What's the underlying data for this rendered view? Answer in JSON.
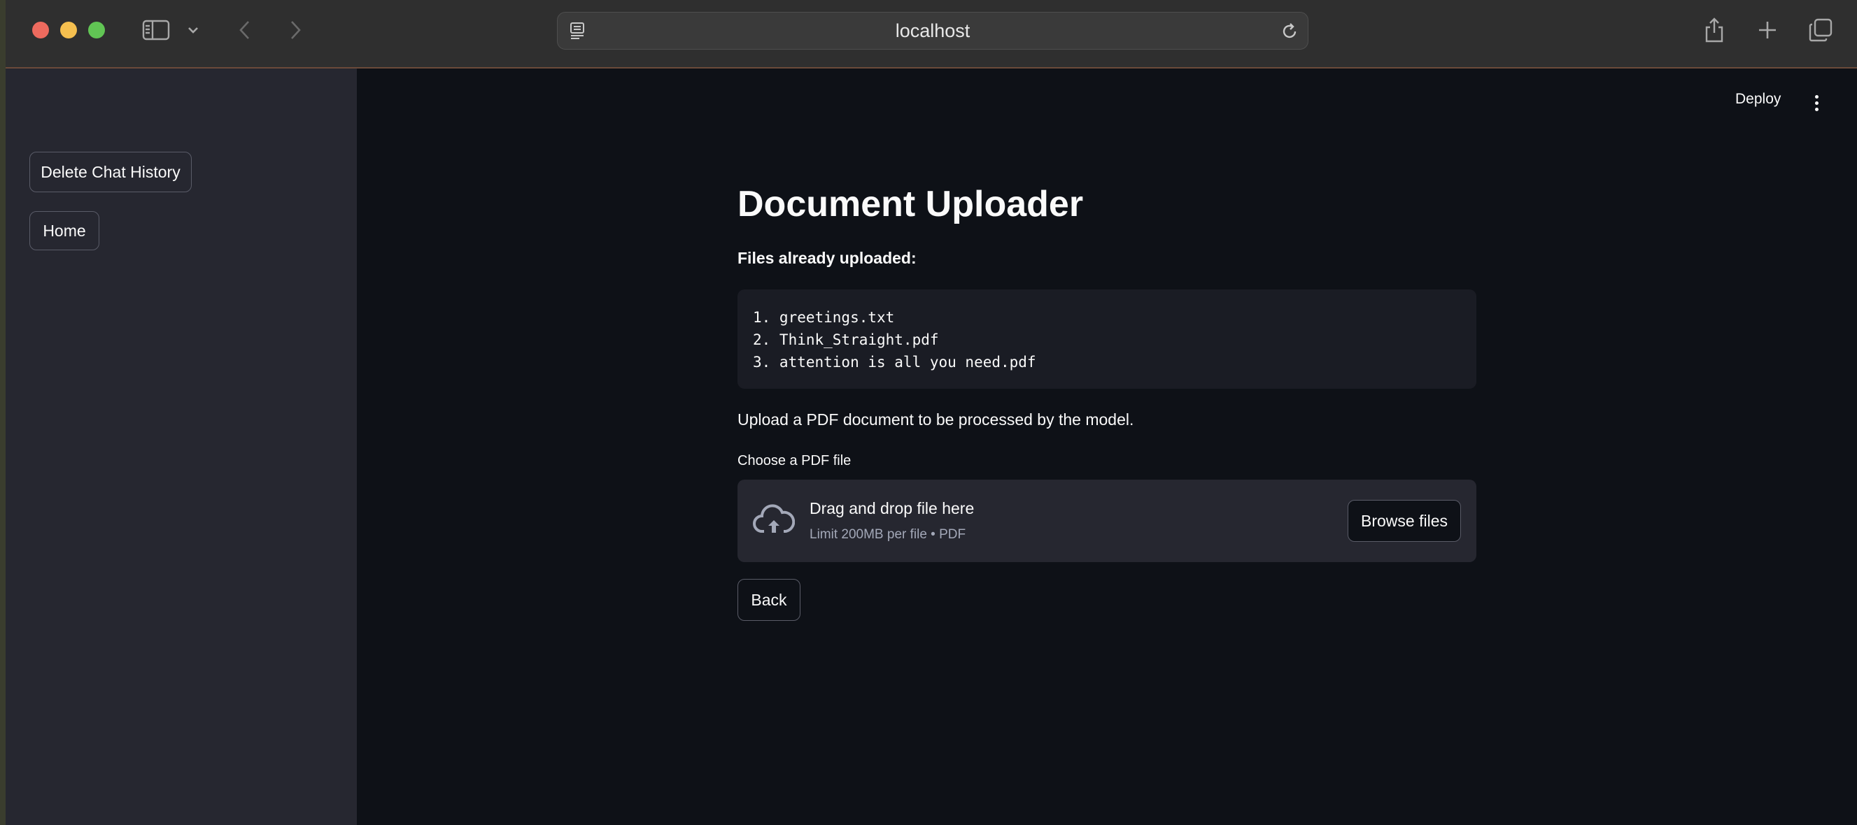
{
  "browser": {
    "url": "localhost",
    "icons": {
      "sidebar_toggle": "sidebar-icon",
      "chevron": "chevron-down-icon",
      "back": "chevron-left-icon",
      "forward": "chevron-right-icon",
      "reader": "reader-icon",
      "reload": "reload-icon",
      "share": "share-icon",
      "new_tab": "plus-icon",
      "tabs": "tab-overview-icon"
    }
  },
  "sidebar": {
    "delete_label": "Delete Chat History",
    "home_label": "Home"
  },
  "header": {
    "deploy_label": "Deploy"
  },
  "main": {
    "title": "Document Uploader",
    "files_heading": "Files already uploaded:",
    "files": [
      "1. greetings.txt",
      "2. Think_Straight.pdf",
      "3. attention is all you need.pdf"
    ],
    "upload_description": "Upload a PDF document to be processed by the model.",
    "uploader": {
      "label": "Choose a PDF file",
      "drop_title": "Drag and drop file here",
      "drop_limit": "Limit 200MB per file • PDF",
      "browse_label": "Browse files"
    },
    "back_label": "Back"
  },
  "colors": {
    "background": "#0e1117",
    "sidebar": "#262730",
    "text": "#fafafa",
    "muted": "#a3a8b8",
    "toolbar": "#2f2f2f"
  }
}
